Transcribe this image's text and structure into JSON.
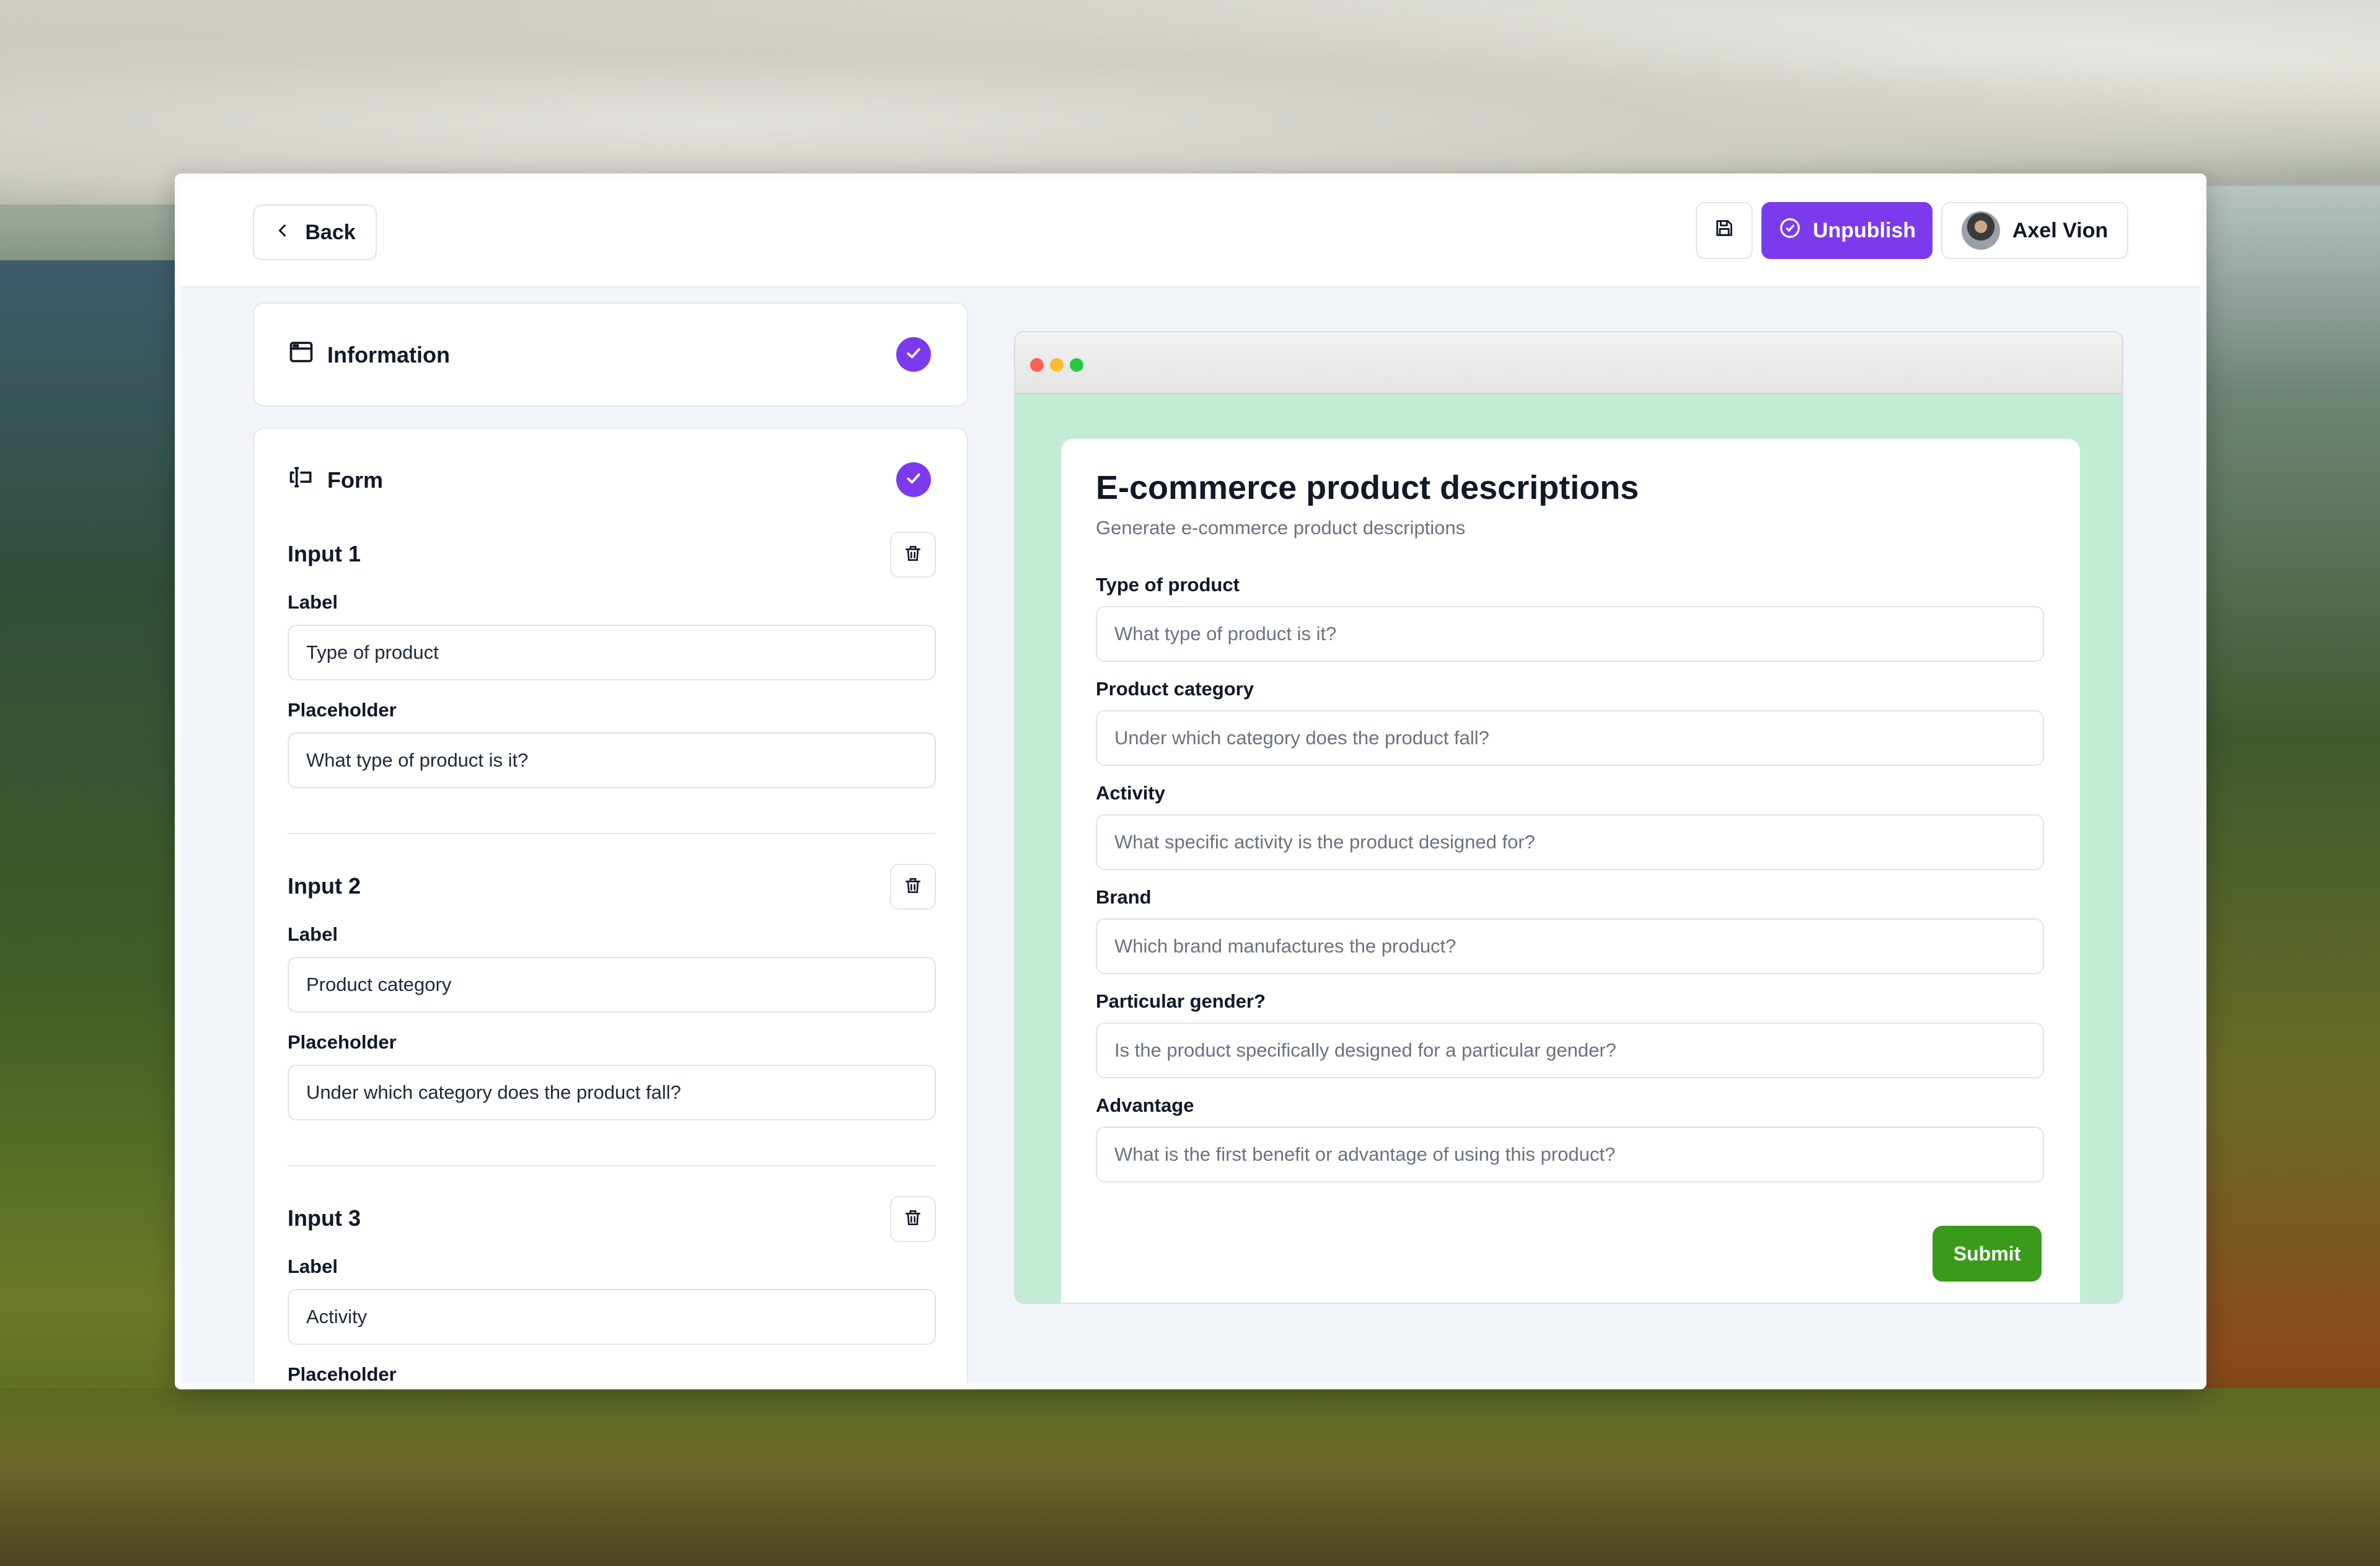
{
  "topbar": {
    "back_label": "Back",
    "unpublish_label": "Unpublish",
    "user_name": "Axel Vion"
  },
  "information": {
    "title": "Information"
  },
  "form": {
    "title": "Form",
    "inputs": [
      {
        "title": "Input 1",
        "label_caption": "Label",
        "label_value": "Type of product",
        "placeholder_caption": "Placeholder",
        "placeholder_value": "What type of product is it?"
      },
      {
        "title": "Input 2",
        "label_caption": "Label",
        "label_value": "Product category",
        "placeholder_caption": "Placeholder",
        "placeholder_value": "Under which category does the product fall?"
      },
      {
        "title": "Input 3",
        "label_caption": "Label",
        "label_value": "Activity",
        "placeholder_caption": "Placeholder"
      }
    ]
  },
  "preview": {
    "title": "E-commerce product descriptions",
    "subtitle": "Generate e-commerce product descriptions",
    "fields": [
      {
        "label": "Type of product",
        "placeholder": "What type of product is it?"
      },
      {
        "label": "Product category",
        "placeholder": "Under which category does the product fall?"
      },
      {
        "label": "Activity",
        "placeholder": "What specific activity is the product designed for?"
      },
      {
        "label": "Brand",
        "placeholder": "Which brand manufactures the product?"
      },
      {
        "label": "Particular gender?",
        "placeholder": "Is the product specifically designed for a particular gender?"
      },
      {
        "label": "Advantage",
        "placeholder": "What is the first benefit or advantage of using this product?"
      }
    ],
    "submit_label": "Submit"
  },
  "colors": {
    "accent": "#7c3aed",
    "preview_background": "#c2ecd6",
    "submit": "#3a9a1a",
    "chat": "#a21caf"
  },
  "icons": [
    "chevron-left-icon",
    "save-icon",
    "check-circle-icon",
    "window-icon",
    "form-icon",
    "check-icon",
    "trash-icon",
    "chat-icon"
  ]
}
